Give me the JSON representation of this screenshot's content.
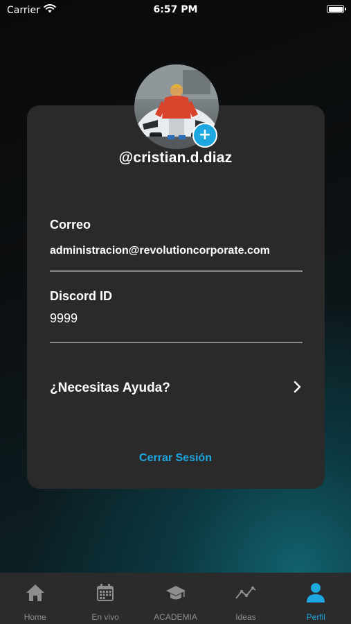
{
  "status_bar": {
    "carrier": "Carrier",
    "time": "6:57 PM",
    "icons": [
      "wifi-icon",
      "battery-icon"
    ]
  },
  "profile": {
    "username": "@cristian.d.diaz",
    "avatar_add_symbol": "+"
  },
  "fields": {
    "email_label": "Correo",
    "email_value": "administracion@revolutioncorporate.com",
    "discord_label": "Discord ID",
    "discord_value": "9999"
  },
  "help": {
    "label": "¿Necesitas Ayuda?",
    "icon": "chevron-right-icon"
  },
  "logout_label": "Cerrar Sesión",
  "tabbar": {
    "active_tab": "Perfil",
    "items": [
      {
        "label": "Home",
        "icon": "home-icon"
      },
      {
        "label": "En vivo",
        "icon": "calendar-icon"
      },
      {
        "label": "ACADEMIA",
        "icon": "graduation-cap-icon"
      },
      {
        "label": "Ideas",
        "icon": "trend-line-icon"
      },
      {
        "label": "Perfil",
        "icon": "user-icon"
      }
    ]
  },
  "colors": {
    "accent": "#1ea7e1",
    "card": "#2a2a2a",
    "tabbar": "#2b2b2b",
    "inactive_tab": "#8e8e8e"
  }
}
